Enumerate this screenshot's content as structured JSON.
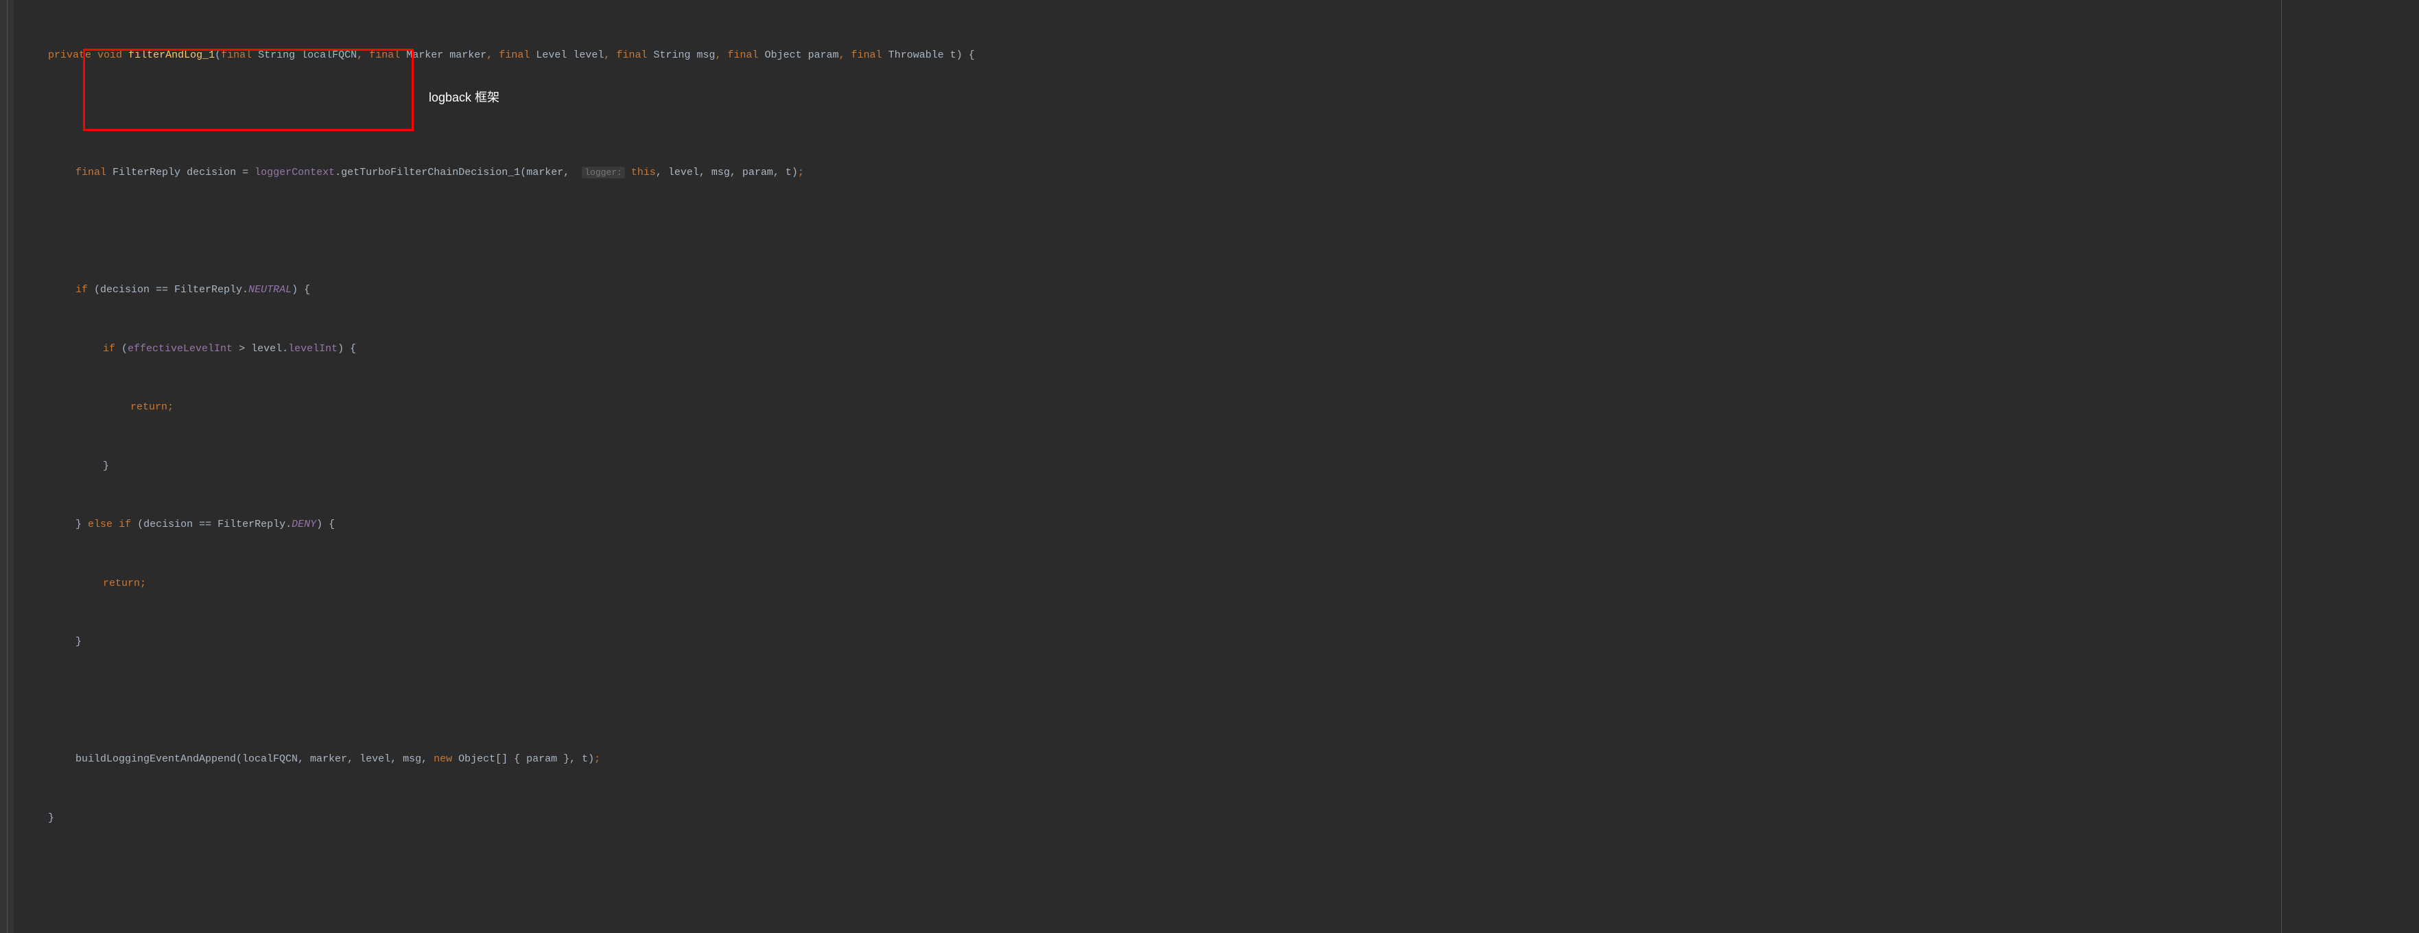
{
  "code": {
    "line1": {
      "kw_private": "private",
      "kw_void": "void",
      "method": "filterAndLog_1",
      "p1_final": "final",
      "p1_type": "String",
      "p1_name": "localFQCN",
      "p2_final": "final",
      "p2_type": "Marker",
      "p2_name": "marker",
      "p3_final": "final",
      "p3_type": "Level",
      "p3_name": "level",
      "p4_final": "final",
      "p4_type": "String",
      "p4_name": "msg",
      "p5_final": "final",
      "p5_type": "Object",
      "p5_name": "param",
      "p6_final": "final",
      "p6_type": "Throwable",
      "p6_name": "t"
    },
    "line2": {
      "kw_final": "final",
      "type": "FilterReply",
      "var": "decision",
      "eq": "=",
      "ctx": "loggerContext",
      "call": ".getTurboFilterChainDecision_1(marker,",
      "hint": "logger:",
      "kw_this": "this",
      "rest": ", level, msg, param, t)"
    },
    "line3": {
      "kw_if": "if",
      "open": " (decision == FilterReply.",
      "neutral": "NEUTRAL",
      "close": ") {"
    },
    "line4": {
      "kw_if": "if",
      "open": " (",
      "f1": "effectiveLevelInt",
      "op": " > ",
      "lvl": "level.",
      "f2": "levelInt",
      "close": ") {"
    },
    "line5": {
      "kw_return": "return"
    },
    "line6": {
      "brace": "}"
    },
    "line7": {
      "brace": "}",
      "kw_else": "else",
      "kw_if": "if",
      "open": " (decision == FilterReply.",
      "deny": "DENY",
      "close": ") {"
    },
    "line8": {
      "kw_return": "return"
    },
    "line9": {
      "brace": "}"
    },
    "line10": {
      "call": "buildLoggingEventAndAppend(localFQCN, marker, level, msg, ",
      "kw_new": "new",
      "arr": " Object[] { param }, t)"
    },
    "line11": {
      "brace": "}"
    }
  },
  "annotation": "logback 框架"
}
